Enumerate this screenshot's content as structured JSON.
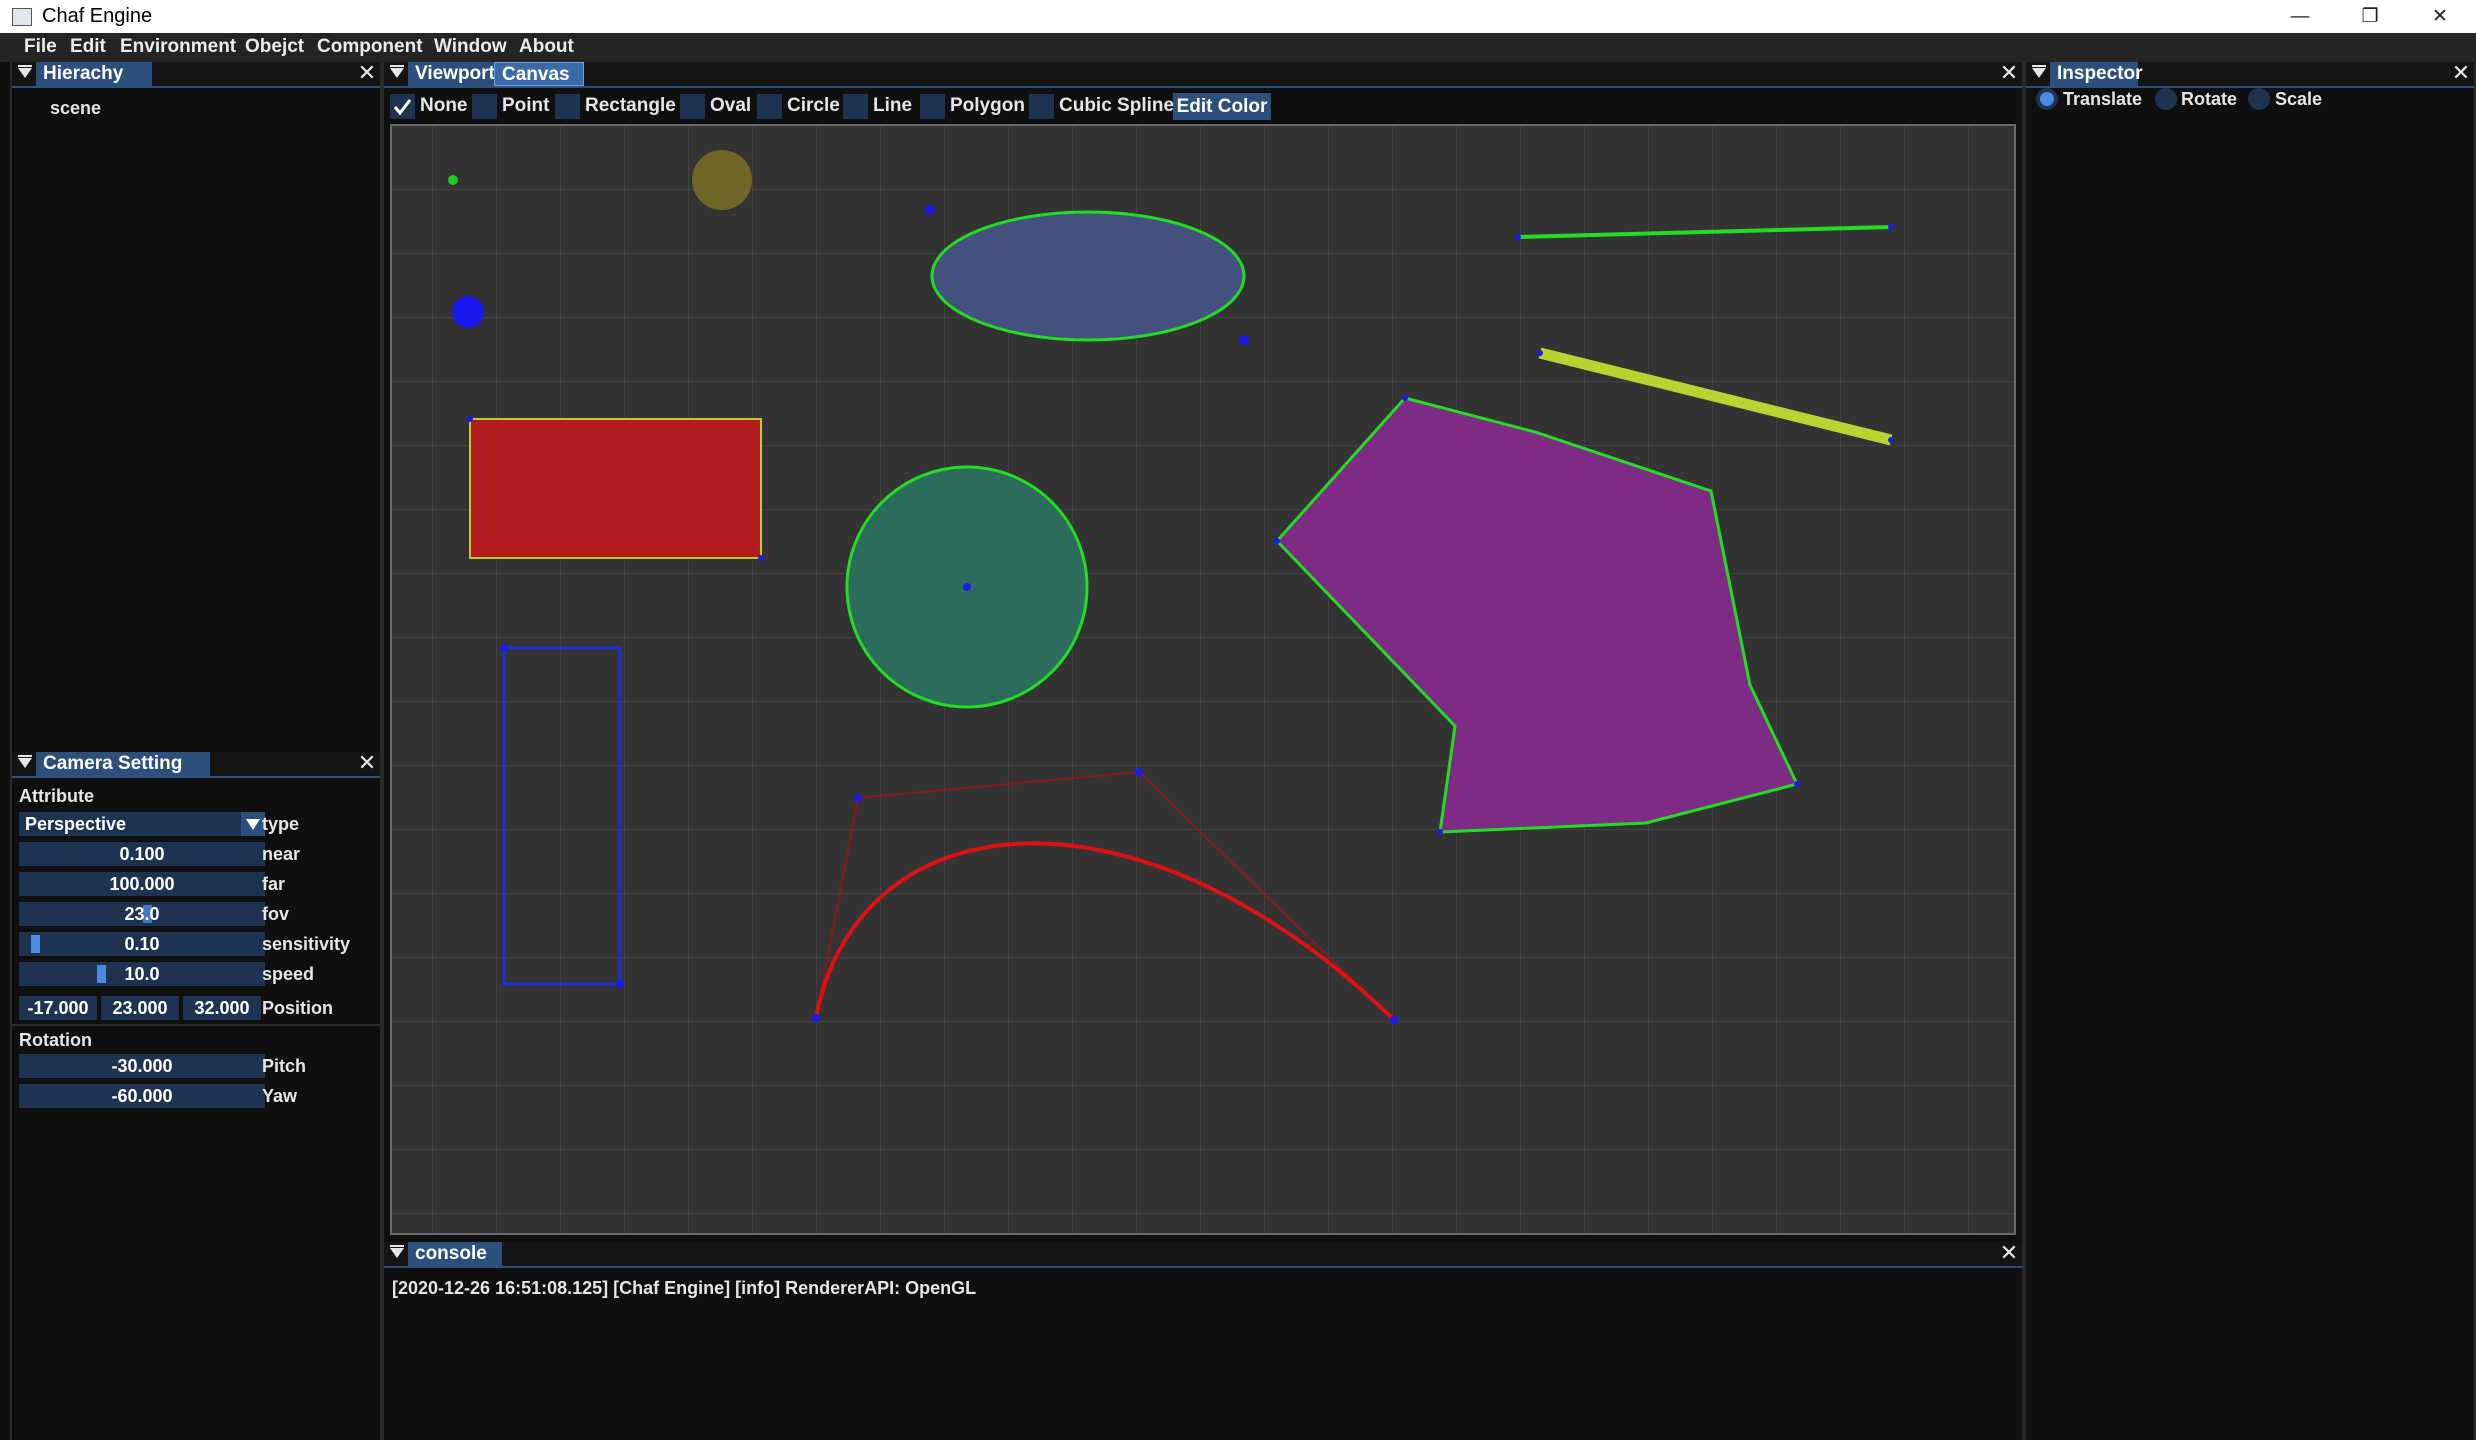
{
  "window": {
    "title": "Chaf Engine",
    "minimize": "—",
    "restore": "❐",
    "close": "✕"
  },
  "menu": [
    "File",
    "Edit",
    "Environment",
    "Obejct",
    "Component",
    "Window",
    "About"
  ],
  "hierarchy": {
    "tab": "Hierachy",
    "items": [
      "scene"
    ]
  },
  "camera": {
    "tab": "Camera Setting",
    "attribute_header": "Attribute",
    "type_value": "Perspective",
    "type_label": "type",
    "near_value": "0.100",
    "near_label": "near",
    "far_value": "100.000",
    "far_label": "far",
    "fov_value": "23.0",
    "fov_label": "fov",
    "sensitivity_value": "0.10",
    "sensitivity_label": "sensitivity",
    "sensitivity_level": 0.05,
    "speed_value": "10.0",
    "speed_label": "speed",
    "speed_level": 0.33,
    "position": [
      "-17.000",
      "23.000",
      "32.000"
    ],
    "position_label": "Position",
    "rotation_header": "Rotation",
    "pitch_value": "-30.000",
    "pitch_label": "Pitch",
    "yaw_value": "-60.000",
    "yaw_label": "Yaw"
  },
  "viewport": {
    "tabs": [
      "Viewport",
      "Canvas"
    ],
    "tools": [
      {
        "label": "None",
        "checked": true
      },
      {
        "label": "Point",
        "checked": false
      },
      {
        "label": "Rectangle",
        "checked": false
      },
      {
        "label": "Oval",
        "checked": false
      },
      {
        "label": "Circle",
        "checked": false
      },
      {
        "label": "Line",
        "checked": false
      },
      {
        "label": "Polygon",
        "checked": false
      },
      {
        "label": "Cubic Spline",
        "checked": false
      }
    ],
    "edit_color": "Edit Color"
  },
  "inspector": {
    "tab": "Inspector",
    "modes": [
      {
        "label": "Translate",
        "selected": true
      },
      {
        "label": "Rotate",
        "selected": false
      },
      {
        "label": "Scale",
        "selected": false
      }
    ]
  },
  "console": {
    "tab": "console",
    "log": "[2020-12-26 16:51:08.125] [Chaf Engine] [info] RendererAPI: OpenGL"
  },
  "colors": {
    "tab_active": "#2d4f7c",
    "field": "#1e3352",
    "accent": "#4a8ae0",
    "shape_outline": "#22dd22",
    "rect_fill": "#b11b1d",
    "polygon_fill": "#7e2b86",
    "spline": "#dd1111",
    "thick_line": "#b8d431"
  }
}
